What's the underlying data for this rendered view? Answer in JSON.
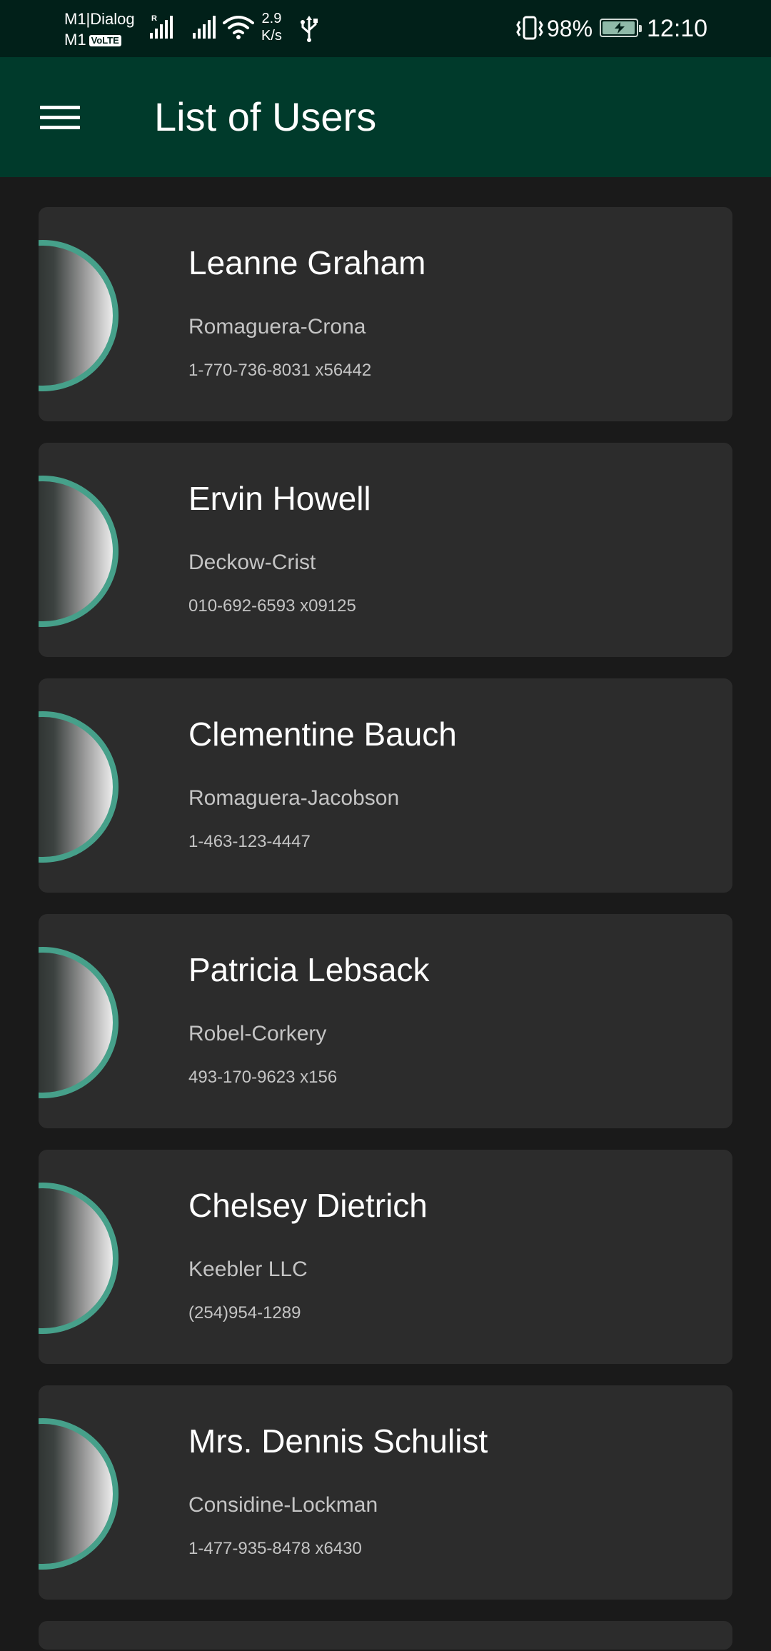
{
  "status_bar": {
    "carrier_1": "M1|Dialog",
    "carrier_2": "M1",
    "volte_badge": "VoLTE",
    "roaming_indicator": "R",
    "network_speed_value": "2.9",
    "network_speed_unit": "K/s",
    "battery_percent": "98%",
    "battery_level": 0.98,
    "time": "12:10",
    "icons": [
      "signal-icon",
      "wifi-icon",
      "usb-icon",
      "vibrate-icon",
      "battery-charging-icon"
    ]
  },
  "app_bar": {
    "title": "List of Users",
    "menu_icon": "hamburger-menu-icon"
  },
  "colors": {
    "status_bar_bg": "#012019",
    "app_bar_bg": "#003a2b",
    "page_bg": "#1a1a1a",
    "card_bg": "#2c2c2c",
    "avatar_ring": "#46a08a",
    "secondary_text": "#c4c4c4"
  },
  "users": [
    {
      "name": "Leanne Graham",
      "company": "Romaguera-Crona",
      "phone": "1-770-736-8031 x56442"
    },
    {
      "name": "Ervin Howell",
      "company": "Deckow-Crist",
      "phone": "010-692-6593 x09125"
    },
    {
      "name": "Clementine Bauch",
      "company": "Romaguera-Jacobson",
      "phone": "1-463-123-4447"
    },
    {
      "name": "Patricia Lebsack",
      "company": "Robel-Corkery",
      "phone": "493-170-9623 x156"
    },
    {
      "name": "Chelsey Dietrich",
      "company": "Keebler LLC",
      "phone": "(254)954-1289"
    },
    {
      "name": "Mrs. Dennis Schulist",
      "company": "Considine-Lockman",
      "phone": "1-477-935-8478 x6430"
    }
  ]
}
